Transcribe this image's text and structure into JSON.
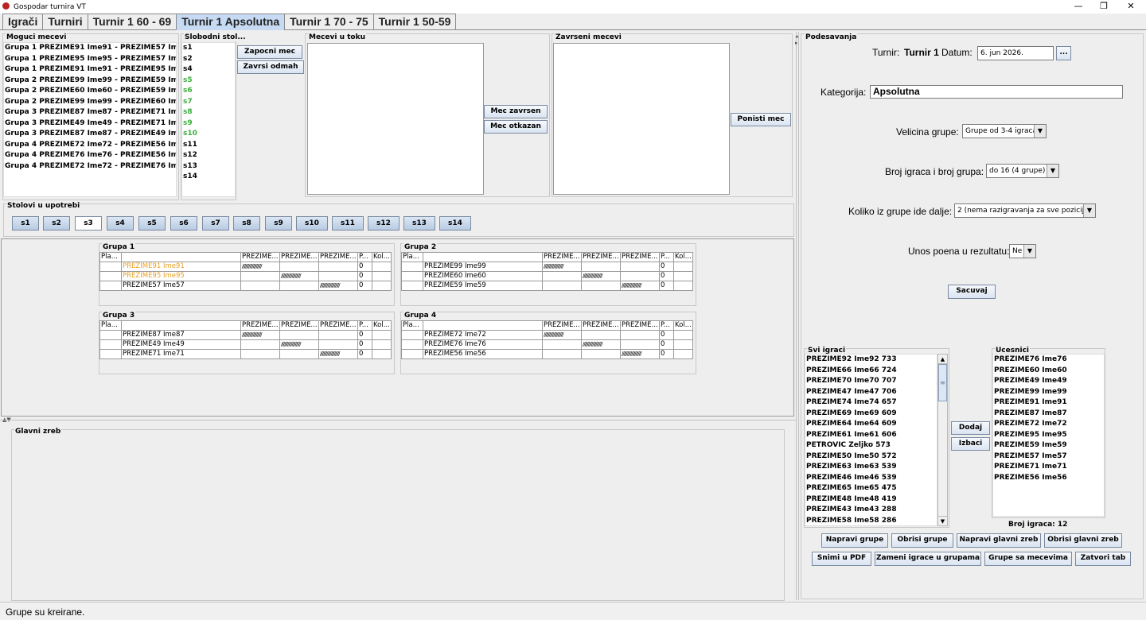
{
  "window": {
    "title": "Gospodar turnira VT",
    "minimize": "—",
    "maximize": "❐",
    "close": "✕"
  },
  "tabs": [
    "Igrači",
    "Turniri",
    "Turnir 1 60 - 69",
    "Turnir 1 Apsolutna",
    "Turnir 1 70 - 75",
    "Turnir 1 50-59"
  ],
  "active_tab": 3,
  "moguci": {
    "label": "Moguci mecevi",
    "items": [
      "Grupa 1 PREZIME91 Ime91 - PREZIME57 Ime57",
      "Grupa 1 PREZIME95 Ime95 - PREZIME57 Ime57",
      "Grupa 1 PREZIME91 Ime91 - PREZIME95 Ime95",
      "Grupa 2 PREZIME99 Ime99 - PREZIME59 Ime59",
      "Grupa 2 PREZIME60 Ime60 - PREZIME59 Ime59",
      "Grupa 2 PREZIME99 Ime99 - PREZIME60 Ime60",
      "Grupa 3 PREZIME87 Ime87 - PREZIME71 Ime71",
      "Grupa 3 PREZIME49 Ime49 - PREZIME71 Ime71",
      "Grupa 3 PREZIME87 Ime87 - PREZIME49 Ime49",
      "Grupa 4 PREZIME72 Ime72 - PREZIME56 Ime56",
      "Grupa 4 PREZIME76 Ime76 - PREZIME56 Ime56",
      "Grupa 4 PREZIME72 Ime72 - PREZIME76 Ime76"
    ]
  },
  "slobodni": {
    "label": "Slobodni stol...",
    "items": [
      {
        "t": "s1",
        "c": "#000000"
      },
      {
        "t": "s2",
        "c": "#000000"
      },
      {
        "t": "s4",
        "c": "#000000"
      },
      {
        "t": "s5",
        "c": "#3cae3c"
      },
      {
        "t": "s6",
        "c": "#3cae3c"
      },
      {
        "t": "s7",
        "c": "#3cae3c"
      },
      {
        "t": "s8",
        "c": "#3cae3c"
      },
      {
        "t": "s9",
        "c": "#3cae3c"
      },
      {
        "t": "s10",
        "c": "#3cae3c"
      },
      {
        "t": "s11",
        "c": "#000000"
      },
      {
        "t": "s12",
        "c": "#000000"
      },
      {
        "t": "s13",
        "c": "#000000"
      },
      {
        "t": "s14",
        "c": "#000000"
      }
    ]
  },
  "buttons": {
    "zapocni": "Zapocni mec",
    "zavrsi": "Zavrsi odmah",
    "mec_zavrsen": "Mec zavrsen",
    "mec_otkazan": "Mec otkazan",
    "ponisti": "Ponisti mec"
  },
  "u_toku": {
    "label": "Mecevi u toku"
  },
  "zavrseni": {
    "label": "Zavrseni mecevi"
  },
  "stolovi": {
    "label": "Stolovi u upotrebi",
    "items": [
      "s1",
      "s2",
      "s3",
      "s4",
      "s5",
      "s6",
      "s7",
      "s8",
      "s9",
      "s10",
      "s11",
      "s12",
      "s13",
      "s14"
    ],
    "selected": 2
  },
  "group_headers": [
    "Pla...",
    "",
    "PREZIME...",
    "PREZIME...",
    "PREZIME...",
    "P...",
    "Kol..."
  ],
  "groups": [
    {
      "title": "Grupa 1",
      "rows": [
        {
          "name": "PREZIME91 Ime91",
          "color": "#e8a020",
          "pts": "0",
          "x": 2
        },
        {
          "name": "PREZIME95 Ime95",
          "color": "#e8a020",
          "pts": "0",
          "x": 3
        },
        {
          "name": "PREZIME57 Ime57",
          "color": "#000000",
          "pts": "0",
          "x": 4
        }
      ]
    },
    {
      "title": "Grupa 2",
      "rows": [
        {
          "name": "PREZIME99 Ime99",
          "color": "#000000",
          "pts": "0",
          "x": 2
        },
        {
          "name": "PREZIME60 Ime60",
          "color": "#000000",
          "pts": "0",
          "x": 3
        },
        {
          "name": "PREZIME59 Ime59",
          "color": "#000000",
          "pts": "0",
          "x": 4
        }
      ]
    },
    {
      "title": "Grupa 3",
      "rows": [
        {
          "name": "PREZIME87 Ime87",
          "color": "#000000",
          "pts": "0",
          "x": 2
        },
        {
          "name": "PREZIME49 Ime49",
          "color": "#000000",
          "pts": "0",
          "x": 3
        },
        {
          "name": "PREZIME71 Ime71",
          "color": "#000000",
          "pts": "0",
          "x": 4
        }
      ]
    },
    {
      "title": "Grupa 4",
      "rows": [
        {
          "name": "PREZIME72 Ime72",
          "color": "#000000",
          "pts": "0",
          "x": 2
        },
        {
          "name": "PREZIME76 Ime76",
          "color": "#000000",
          "pts": "0",
          "x": 3
        },
        {
          "name": "PREZIME56 Ime56",
          "color": "#000000",
          "pts": "0",
          "x": 4
        }
      ]
    }
  ],
  "hatch": "//////////////////",
  "glavni": {
    "label": "Glavni zreb"
  },
  "settings": {
    "label": "Podesavanja",
    "turnir_label": "Turnir:",
    "turnir_value": "Turnir 1",
    "datum_label": "Datum:",
    "datum_value": "6. jun 2026.",
    "datum_btn": "...",
    "kategorija_label": "Kategorija:",
    "kategorija_value": "Apsolutna",
    "velicina_label": "Velicina grupe:",
    "velicina_value": "Grupe od 3-4 igraca",
    "broj_label": "Broj igraca i broj grupa:",
    "broj_value": "do 16 (4 grupe)",
    "koliko_label": "Koliko iz grupe ide dalje:",
    "koliko_value": "2 (nema razigravanja za sve pozicije)",
    "unos_label": "Unos poena u rezultatu:",
    "unos_value": "Ne",
    "sacuvaj": "Sacuvaj"
  },
  "svi": {
    "label": "Svi igraci",
    "items": [
      "PREZIME92 Ime92 733",
      "PREZIME66 Ime66 724",
      "PREZIME70 Ime70 707",
      "PREZIME47 Ime47 706",
      "PREZIME74 Ime74 657",
      "PREZIME69 Ime69 609",
      "PREZIME64 Ime64 609",
      "PREZIME61 Ime61 606",
      "PETROVIC Zeljko 573",
      "PREZIME50 Ime50 572",
      "PREZIME63 Ime63 539",
      "PREZIME46 Ime46 539",
      "PREZIME65 Ime65 475",
      "PREZIME48 Ime48 419",
      "PREZIME43 Ime43 288",
      "PREZIME58 Ime58 286"
    ]
  },
  "ucesnici": {
    "label": "Ucesnici",
    "items": [
      "PREZIME76 Ime76",
      "PREZIME60 Ime60",
      "PREZIME49 Ime49",
      "PREZIME99 Ime99",
      "PREZIME91 Ime91",
      "PREZIME87 Ime87",
      "PREZIME72 Ime72",
      "PREZIME95 Ime95",
      "PREZIME59 Ime59",
      "PREZIME57 Ime57",
      "PREZIME71 Ime71",
      "PREZIME56 Ime56"
    ],
    "count": "Broj igraca: 12"
  },
  "dodaj": "Dodaj",
  "izbaci": "Izbaci",
  "bottom_buttons": {
    "napravi_grupe": "Napravi grupe",
    "obrisi_grupe": "Obrisi grupe",
    "napravi_glavni": "Napravi glavni zreb",
    "obrisi_glavni": "Obrisi glavni zreb",
    "snimi": "Snimi u PDF",
    "zameni": "Zameni igrace u grupama",
    "grupe_mecevi": "Grupe sa mecevima",
    "zatvori": "Zatvori tab"
  },
  "status": "Grupe su kreirane."
}
